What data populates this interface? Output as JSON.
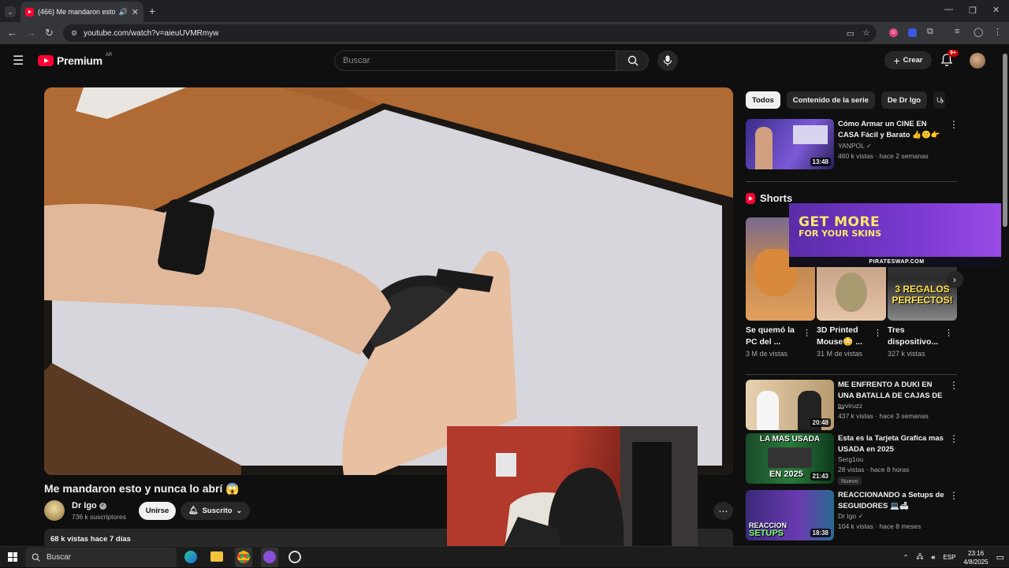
{
  "browser": {
    "tab_title": "(466) Me mandaron esto y nunca lo abrí",
    "url": "youtube.com/watch?v=aieuUVMRmyw"
  },
  "header": {
    "logo_text": "Premium",
    "country_code": "AR",
    "search_placeholder": "Buscar",
    "create_label": "Crear",
    "notif_count": "9+"
  },
  "video": {
    "title": "Me mandaron esto y nunca lo abrí 😱",
    "channel": "Dr Igo",
    "subscribers": "736 k suscriptores",
    "join_label": "Unirse",
    "subscribed_label": "Suscrito",
    "views_date": "68 k vistas  hace 7 días"
  },
  "chips": [
    "Todos",
    "Contenido de la serie",
    "De Dr Igo",
    "U"
  ],
  "recommended_top": {
    "title": "Cómo Armar un CINE EN CASA Fácil y Barato 👍🙂👉",
    "channel": "YANPOL",
    "meta": "460 k vistas · hace 2 semanas",
    "duration": "13:48"
  },
  "shorts": {
    "heading": "Shorts",
    "items": [
      {
        "title": "Se quemó la PC del ...",
        "views": "3 M de vistas",
        "thumb_text": ""
      },
      {
        "title": "3D Printed Mouse😳 ...",
        "views": "31 M de vistas",
        "thumb_text": ""
      },
      {
        "title": "Tres dispositivo...",
        "views": "327 k vistas",
        "thumb_text": "3 REGALOS PERFECTOS!"
      }
    ]
  },
  "recommended": [
    {
      "title": "ME ENFRENTO A DUKI EN UNA BATALLA DE CAJAS DE ...",
      "channel": "byviruzz",
      "meta": "437 k vistas · hace 3 semanas",
      "duration": "20:48",
      "badge": ""
    },
    {
      "title": "Esta es la Tarjeta Grafica mas USADA en 2025",
      "channel": "Serg1ou",
      "meta": "28 vistas · hace 8 horas",
      "duration": "21:43",
      "badge": "Nuevo",
      "thumb_top": "LA MAS USADA",
      "thumb_bottom": "EN 2025"
    },
    {
      "title": "REACCIONANDO a Setups de SEGUIDORES 💻🛋",
      "channel": "Dr Igo",
      "meta": "104 k vistas · hace 8 meses",
      "duration": "18:38",
      "badge": "",
      "thumb_top": "REACCION",
      "thumb_bottom": "SETUPS"
    }
  ],
  "ad": {
    "line1": "GET MORE",
    "line2": "FOR YOUR SKINS",
    "domain": "PIRATESWAP.COM"
  },
  "taskbar": {
    "search_label": "Buscar",
    "lang": "ESP",
    "time": "23:16",
    "date": "4/8/2025"
  }
}
